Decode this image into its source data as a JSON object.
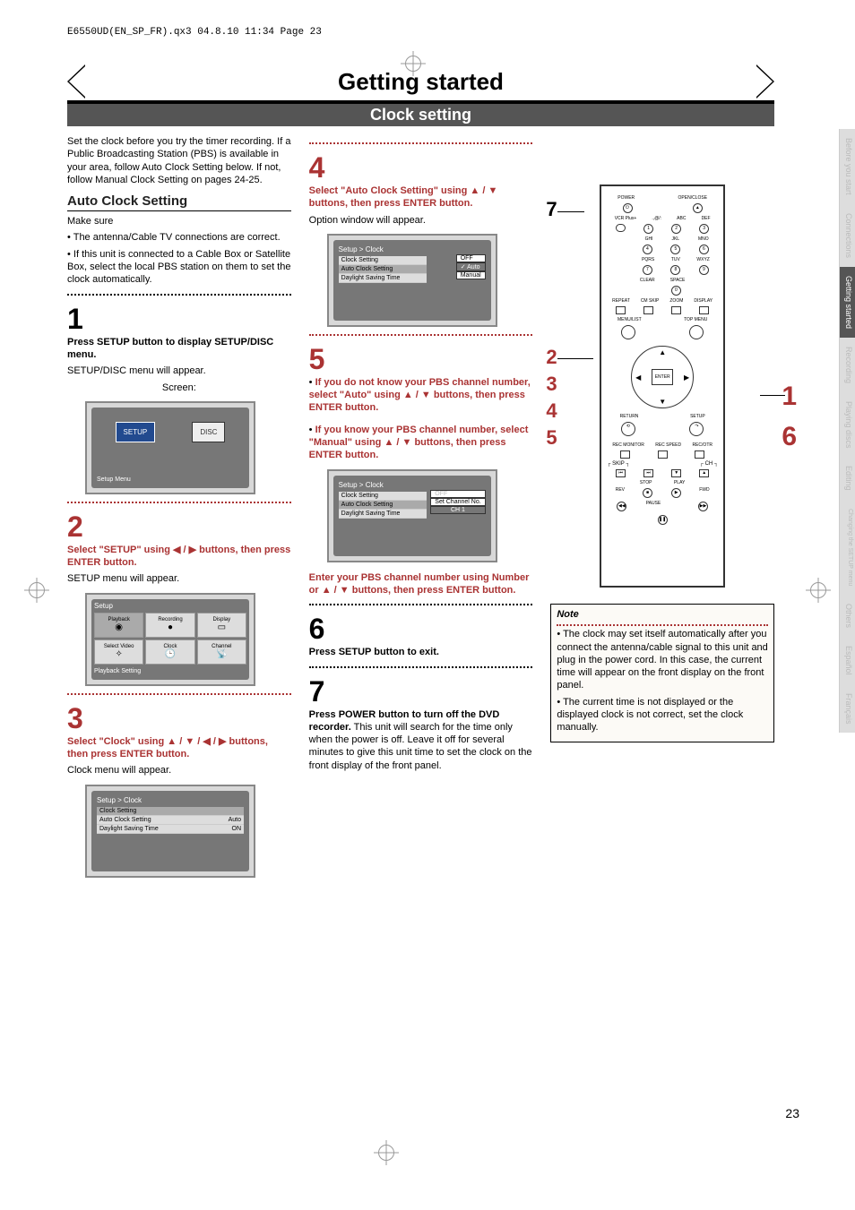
{
  "pageline": "E6550UD(EN_SP_FR).qx3  04.8.10  11:34  Page 23",
  "header": {
    "title": "Getting started",
    "subtitle": "Clock setting"
  },
  "intro": "Set the clock before you try the timer recording. If a Public Broadcasting Station (PBS) is available in your area, follow Auto Clock Setting below. If not, follow Manual Clock Setting on pages 24-25.",
  "auto_clock": {
    "heading": "Auto Clock Setting",
    "makesure": "Make sure",
    "b1": "The antenna/Cable TV connections are correct.",
    "b2": "If this unit is connected to a Cable Box or Satellite Box, select the local PBS station on them to set the clock automatically."
  },
  "steps": {
    "s1": {
      "num": "1",
      "a": "Press SETUP button to display SETUP/DISC menu.",
      "b": "SETUP/DISC menu will appear.",
      "c": "Screen:"
    },
    "s2": {
      "num": "2",
      "a": "Select \"SETUP\" using ◀ / ▶ buttons, then press ENTER button.",
      "b": "SETUP menu will appear."
    },
    "s3": {
      "num": "3",
      "a": "Select \"Clock\" using ▲ / ▼ / ◀ / ▶ buttons, then press ENTER button.",
      "b": "Clock menu will appear."
    },
    "s4": {
      "num": "4",
      "a": "Select \"Auto Clock Setting\" using ▲ / ▼ buttons, then press ENTER button.",
      "b": "Option window will appear."
    },
    "s5": {
      "num": "5",
      "a": "If you do not know your PBS channel number, select \"Auto\" using ▲ / ▼ buttons, then press ENTER button.",
      "b": "If you know your PBS channel number, select \"Manual\" using ▲ / ▼ buttons, then press ENTER button.",
      "c": "Enter your PBS channel number using Number or ▲ / ▼ buttons, then press ENTER button."
    },
    "s6": {
      "num": "6",
      "a": "Press SETUP button to exit."
    },
    "s7": {
      "num": "7",
      "a": "Press POWER button to turn off the DVD recorder.",
      "b": " This unit will search for the time only when the power is off. Leave it off for several minutes to give this unit time to set the clock on the front display of the front panel."
    }
  },
  "screen1": {
    "setup": "SETUP",
    "disc": "DISC",
    "footer": "Setup Menu"
  },
  "screen2": {
    "cells": [
      "Playback",
      "Recording",
      "Display",
      "Select Video",
      "Clock",
      "Channel"
    ],
    "footer": "Playback Setting"
  },
  "screen3": {
    "title": "Setup > Clock",
    "rows": [
      "Clock Setting",
      "Auto Clock Setting",
      "Daylight Saving Time"
    ],
    "vals": [
      "",
      "Auto",
      "ON"
    ]
  },
  "screen4": {
    "title": "Setup > Clock",
    "rows": [
      "Clock Setting",
      "Auto Clock Setting",
      "Daylight Saving Time"
    ],
    "opts": [
      "OFF",
      "Auto",
      "Manual"
    ]
  },
  "screen5": {
    "title": "Setup > Clock",
    "rows": [
      "Clock Setting",
      "Auto Clock Setting",
      "Daylight Saving Time"
    ],
    "opts": [
      "OFF",
      "Set Channel No.",
      "CH 1"
    ]
  },
  "remote": {
    "power": "POWER",
    "open": "OPEN/CLOSE",
    "vcrplus": "VCR Plus+",
    "k0": ".,@/:",
    "k1": "ABC",
    "k2": "DEF",
    "k3": "GHI",
    "k4": "JKL",
    "k5": "MNO",
    "k6": "PQRS",
    "k7": "TUV",
    "k8": "WXYZ",
    "clear": "CLEAR",
    "space": "SPACE",
    "repeat": "REPEAT",
    "cmskip": "CM SKIP",
    "zoom": "ZOOM",
    "display": "DISPLAY",
    "menulist": "MENU/LIST",
    "topmenu": "TOP MENU",
    "enter": "ENTER",
    "return": "RETURN",
    "setup": "SETUP",
    "recmon": "REC MONITOR",
    "recspd": "REC SPEED",
    "recotr": "REC/OTR",
    "skip": "SKIP",
    "ch": "CH",
    "stop": "STOP",
    "play": "PLAY",
    "rev": "REV",
    "fwd": "FWD",
    "pause": "PAUSE"
  },
  "note": {
    "title": "Note",
    "n1": "The clock may set itself automatically after you connect the antenna/cable signal to this unit and plug in the power cord. In this case, the current time will appear on the front display on the front panel.",
    "n2": "The current time is not displayed or the displayed clock is not correct, set the clock manually."
  },
  "tabs": [
    "Before you start",
    "Connections",
    "Getting started",
    "Recording",
    "Playing discs",
    "Editing",
    "Changing the SETUP menu",
    "Others",
    "Español",
    "Français"
  ],
  "callouts": {
    "l2": "2",
    "l3": "3",
    "l4": "4",
    "l5": "5",
    "l7": "7",
    "r1": "1",
    "r6": "6"
  },
  "page_number": "23"
}
